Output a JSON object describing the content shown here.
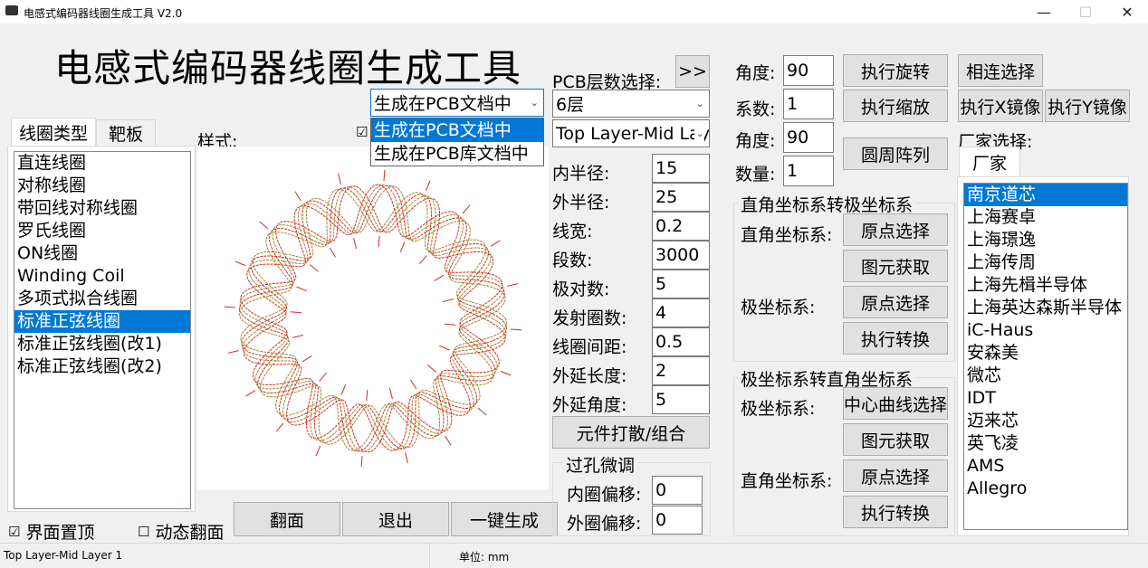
{
  "window": {
    "title": "电感式编码器线圈生成工具 V2.0",
    "minimize": "—",
    "maximize": "☐",
    "close": "✕"
  },
  "heading": "电感式编码器线圈生成工具",
  "target_dropdown": {
    "value": "生成在PCB文档中",
    "options": [
      "生成在PCB文档中",
      "生成在PCB库文档中"
    ]
  },
  "left_tabs": [
    "线圈类型",
    "靶板"
  ],
  "coil_types": [
    "直连线圈",
    "对称线圈",
    "带回线对称线圈",
    "罗氏线圈",
    "ON线圈",
    "Winding Coil",
    "多项式拟合线圈",
    "标准正弦线圈",
    "标准正弦线圈(改1)",
    "标准正弦线圈(改2)"
  ],
  "selected_coil_index": 7,
  "style_label": "样式:",
  "style_checkbox": "☑",
  "pcb_layers": {
    "label": "PCB层数选择:",
    "expand_button": ">>",
    "layer_count": "6层",
    "layer_pair": "Top Layer-Mid Layer 1"
  },
  "params": [
    {
      "label": "内半径:",
      "value": "15"
    },
    {
      "label": "外半径:",
      "value": "25"
    },
    {
      "label": "线宽:",
      "value": "0.2"
    },
    {
      "label": "段数:",
      "value": "3000"
    },
    {
      "label": "极对数:",
      "value": "5"
    },
    {
      "label": "发射圈数:",
      "value": "4"
    },
    {
      "label": "线圈间距:",
      "value": "0.5"
    },
    {
      "label": "外延长度:",
      "value": "2"
    },
    {
      "label": "外延角度:",
      "value": "5"
    }
  ],
  "scatter_button": "元件打散/组合",
  "via_tune": {
    "title": "过孔微调",
    "inner_label": "内圈偏移:",
    "inner_value": "0",
    "outer_label": "外圈偏移:",
    "outer_value": "0"
  },
  "bottom_buttons": {
    "flip": "翻面",
    "exit": "退出",
    "generate": "一键生成"
  },
  "checkboxes": {
    "topmost": {
      "label": "界面置顶",
      "mark": "☑"
    },
    "dyn_flip": {
      "label": "动态翻面",
      "mark": "☐"
    }
  },
  "transform": {
    "rotate": {
      "label": "角度:",
      "value": "90",
      "button": "执行旋转"
    },
    "scale": {
      "label": "系数:",
      "value": "1",
      "button": "执行缩放"
    },
    "array_angle": {
      "label": "角度:",
      "value": "90"
    },
    "array_count": {
      "label": "数量:",
      "value": "1",
      "button": "圆周阵列"
    },
    "connected_select": "相连选择",
    "mirror_x": "执行X镜像",
    "mirror_y": "执行Y镜像"
  },
  "rect_to_polar": {
    "title": "直角坐标系转极坐标系",
    "rect_label": "直角坐标系:",
    "origin_btn_1": "原点选择",
    "fetch_btn": "图元获取",
    "polar_label": "极坐标系:",
    "origin_btn_2": "原点选择",
    "convert_btn": "执行转换"
  },
  "polar_to_rect": {
    "title": "极坐标系转直角坐标系",
    "polar_label": "极坐标系:",
    "center_btn": "中心曲线选择",
    "fetch_btn": "图元获取",
    "rect_label": "直角坐标系:",
    "origin_btn": "原点选择",
    "convert_btn": "执行转换"
  },
  "vendor": {
    "label": "厂家选择:",
    "tab": "厂家",
    "items": [
      "南京道芯",
      "上海赛卓",
      "上海璟逸",
      "上海传周",
      "上海先楫半导体",
      "上海英达森斯半导体",
      "iC-Haus",
      "安森美",
      "微芯",
      "IDT",
      "迈来芯",
      "英飞凌",
      "AMS",
      "Allegro"
    ],
    "selected_index": 0
  },
  "status": {
    "layer": "Top Layer-Mid Layer 1",
    "unit": "单位: mm"
  },
  "colors": {
    "accent": "#0078d7",
    "coil_a": "#d42a2a",
    "coil_b": "#9a8a2a"
  }
}
